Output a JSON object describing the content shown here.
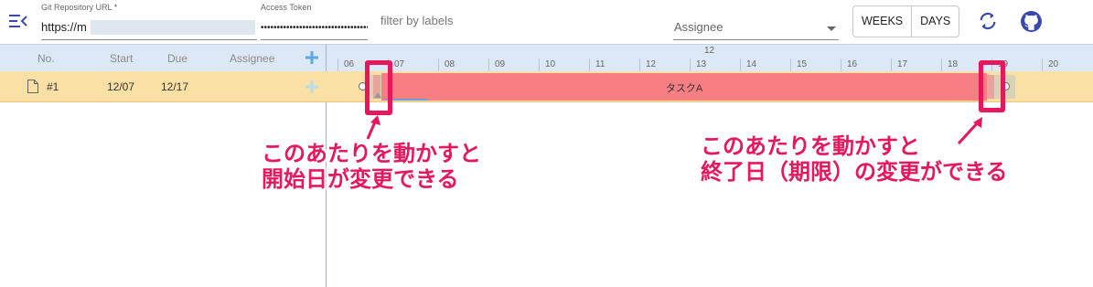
{
  "header": {
    "repo_label": "Git Repository URL *",
    "repo_value": "https://m",
    "token_label": "Access Token",
    "token_value": "••••••••••••••••••••••••••••••••••",
    "filter_placeholder": "filter by labels",
    "assignee_placeholder": "Assignee",
    "weeks_label": "WEEKS",
    "days_label": "DAYS",
    "icons": [
      "menu-collapse-icon",
      "refresh-icon",
      "github-icon"
    ]
  },
  "grid": {
    "columns": [
      "No.",
      "Start",
      "Due",
      "Assignee"
    ],
    "rows": [
      {
        "no": "#1",
        "start": "12/07",
        "due": "12/17",
        "assignee": ""
      }
    ]
  },
  "timeline": {
    "month": "12",
    "days": [
      "06",
      "07",
      "08",
      "09",
      "10",
      "11",
      "12",
      "13",
      "14",
      "15",
      "16",
      "17",
      "18",
      "19",
      "20"
    ]
  },
  "task": {
    "name": "タスクA",
    "bar_color": "#f77f83"
  },
  "annotations": {
    "start_line1": "このあたりを動かすと",
    "start_line2": "開始日が変更できる",
    "end_line1": "このあたりを動かすと",
    "end_line2": "終了日（期限）の変更ができる"
  },
  "colors": {
    "accent": "#3949ab",
    "highlight": "#e5175d",
    "row_bg": "#fbe0a6",
    "header_bg": "#dce8f6"
  }
}
